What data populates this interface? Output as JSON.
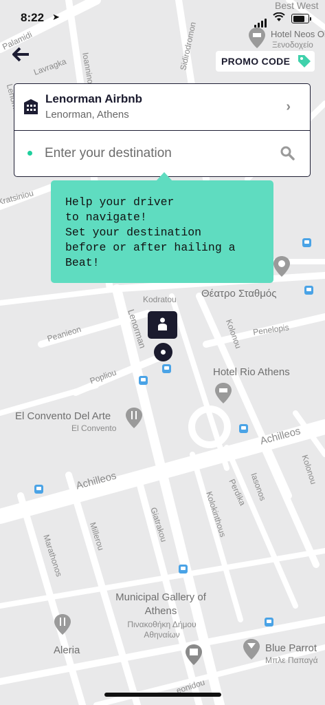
{
  "status_bar": {
    "time": "8:22",
    "location_arrow": "➤",
    "wifi_icon": "wifi-icon",
    "battery_level": 0.8
  },
  "header": {
    "back_icon": "🡐",
    "promo_label": "PROMO CODE"
  },
  "pickup": {
    "title": "Lenorman Airbnb",
    "subtitle": "Lenorman, Athens",
    "chevron": "›"
  },
  "destination": {
    "placeholder": "Enter your destination",
    "value": ""
  },
  "tooltip": {
    "text": "Help your driver\nto navigate!\nSet your destination\nbefore or after hailing a\nBeat!"
  },
  "map": {
    "streets": [
      "Palamidi",
      "Lavragka",
      "Ioannino",
      "Sidirodromon",
      "Best West",
      "Lenorma",
      "Kratsiniou",
      "Kodratou",
      "Lenorman",
      "Peanieon",
      "Popliou",
      "Kolonou",
      "Penelopis",
      "Achilleos",
      "Achilleos",
      "Iasonos",
      "Perdika",
      "Kolokinthous",
      "Giatrakou",
      "Millerou",
      "Marathonos",
      "Kolonou",
      "eonidou"
    ],
    "pois": [
      {
        "name": "Hotel Neos Ol",
        "sub": "Ξενοδοχείο"
      },
      {
        "name": "Θέατρο Σταθμός"
      },
      {
        "name": "Hotel Rio Athens"
      },
      {
        "name": "El Convento Del Arte",
        "sub": "El Convento"
      },
      {
        "name": "Municipal Gallery of Athens",
        "sub": "Πινακοθήκη Δήμου Αθηναίων"
      },
      {
        "name": "Aleria"
      },
      {
        "name": "Blue Parrot",
        "sub": "Μπλε Παπαγά"
      }
    ]
  },
  "colors": {
    "accent": "#5fdcc0",
    "dark": "#1b1b2e",
    "dot": "#1fcf9d"
  }
}
